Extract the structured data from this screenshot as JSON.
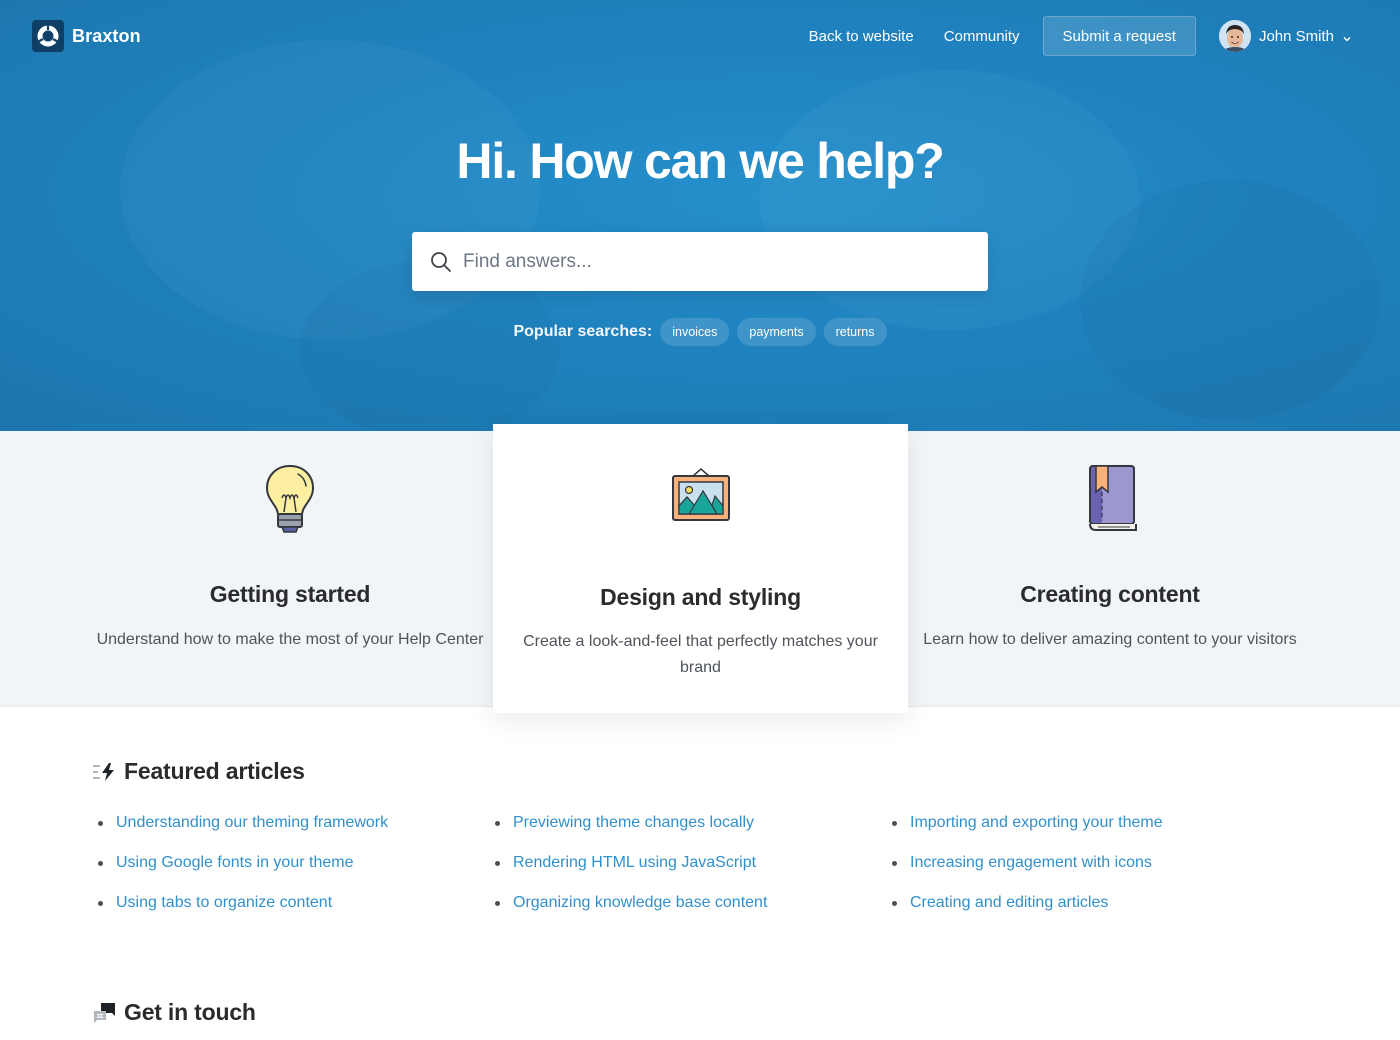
{
  "header": {
    "brand_name": "Braxton",
    "nav": [
      {
        "label": "Back to website"
      },
      {
        "label": "Community"
      }
    ],
    "submit_label": "Submit a request",
    "user_name": "John Smith"
  },
  "hero": {
    "title": "Hi. How can we help?",
    "search_placeholder": "Find answers...",
    "search_value": "",
    "popular_label": "Popular searches:",
    "popular_searches": [
      "invoices",
      "payments",
      "returns"
    ]
  },
  "categories": [
    {
      "icon": "lightbulb-icon",
      "title": "Getting started",
      "description": "Understand how to make the most of your Help Center"
    },
    {
      "icon": "framed-picture-icon",
      "title": "Design and styling",
      "description": "Create a look-and-feel that perfectly matches your brand"
    },
    {
      "icon": "book-icon",
      "title": "Creating content",
      "description": "Learn how to deliver amazing content to your visitors"
    }
  ],
  "featured": {
    "title": "Featured articles",
    "icon": "lightning-icon",
    "columns": [
      [
        "Understanding our theming framework",
        "Using Google fonts in your theme",
        "Using tabs to organize content"
      ],
      [
        "Previewing theme changes locally",
        "Rendering HTML using JavaScript",
        "Organizing knowledge base content"
      ],
      [
        "Importing and exporting your theme",
        "Increasing engagement with icons",
        "Creating and editing articles"
      ]
    ]
  },
  "contact": {
    "title": "Get in touch",
    "icon": "chat-bubbles-icon"
  },
  "colors": {
    "hero_blue": "#1f82bf",
    "link_blue": "#3190c9",
    "band_gray": "#f1f5f8",
    "heading": "#2b2b2e"
  }
}
